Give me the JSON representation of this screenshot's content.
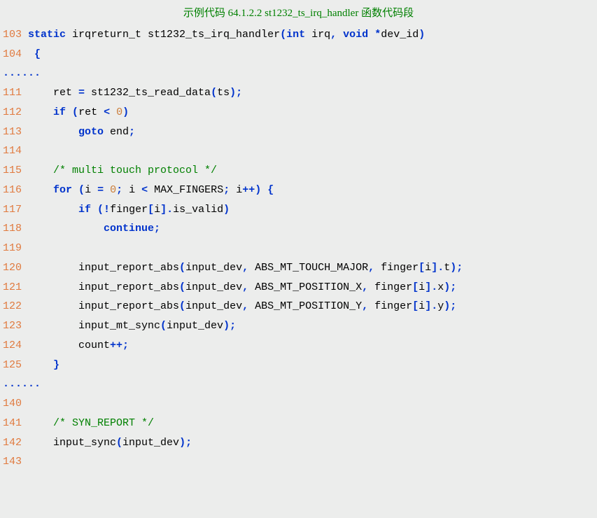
{
  "title": "示例代码 64.1.2.2 st1232_ts_irq_handler 函数代码段",
  "lines": [
    {
      "n": "103",
      "t": [
        {
          "c": "kw",
          "s": "static"
        },
        {
          "c": "plain",
          "s": " irqreturn_t st1232_ts_irq_handler"
        },
        {
          "c": "punct",
          "s": "("
        },
        {
          "c": "type",
          "s": "int"
        },
        {
          "c": "plain",
          "s": " irq"
        },
        {
          "c": "punct",
          "s": ","
        },
        {
          "c": "plain",
          "s": " "
        },
        {
          "c": "type",
          "s": "void"
        },
        {
          "c": "plain",
          "s": " "
        },
        {
          "c": "punct",
          "s": "*"
        },
        {
          "c": "plain",
          "s": "dev_id"
        },
        {
          "c": "punct",
          "s": ")"
        }
      ]
    },
    {
      "n": "104",
      "t": [
        {
          "c": "plain",
          "s": " "
        },
        {
          "c": "punct",
          "s": "{"
        }
      ]
    },
    {
      "n": "",
      "ell": true
    },
    {
      "n": "111",
      "t": [
        {
          "c": "plain",
          "s": "    ret "
        },
        {
          "c": "punct",
          "s": "="
        },
        {
          "c": "plain",
          "s": " st1232_ts_read_data"
        },
        {
          "c": "punct",
          "s": "("
        },
        {
          "c": "plain",
          "s": "ts"
        },
        {
          "c": "punct",
          "s": ");"
        }
      ]
    },
    {
      "n": "112",
      "t": [
        {
          "c": "plain",
          "s": "    "
        },
        {
          "c": "kw",
          "s": "if"
        },
        {
          "c": "plain",
          "s": " "
        },
        {
          "c": "punct",
          "s": "("
        },
        {
          "c": "plain",
          "s": "ret "
        },
        {
          "c": "punct",
          "s": "<"
        },
        {
          "c": "plain",
          "s": " "
        },
        {
          "c": "num",
          "s": "0"
        },
        {
          "c": "punct",
          "s": ")"
        }
      ]
    },
    {
      "n": "113",
      "t": [
        {
          "c": "plain",
          "s": "        "
        },
        {
          "c": "kw",
          "s": "goto"
        },
        {
          "c": "plain",
          "s": " end"
        },
        {
          "c": "punct",
          "s": ";"
        }
      ]
    },
    {
      "n": "114",
      "t": [
        {
          "c": "plain",
          "s": ""
        }
      ]
    },
    {
      "n": "115",
      "t": [
        {
          "c": "plain",
          "s": "    "
        },
        {
          "c": "comment",
          "s": "/* multi touch protocol */"
        }
      ]
    },
    {
      "n": "116",
      "t": [
        {
          "c": "plain",
          "s": "    "
        },
        {
          "c": "kw",
          "s": "for"
        },
        {
          "c": "plain",
          "s": " "
        },
        {
          "c": "punct",
          "s": "("
        },
        {
          "c": "plain",
          "s": "i "
        },
        {
          "c": "punct",
          "s": "="
        },
        {
          "c": "plain",
          "s": " "
        },
        {
          "c": "num",
          "s": "0"
        },
        {
          "c": "punct",
          "s": ";"
        },
        {
          "c": "plain",
          "s": " i "
        },
        {
          "c": "punct",
          "s": "<"
        },
        {
          "c": "plain",
          "s": " MAX_FINGERS"
        },
        {
          "c": "punct",
          "s": ";"
        },
        {
          "c": "plain",
          "s": " i"
        },
        {
          "c": "punct",
          "s": "++)"
        },
        {
          "c": "plain",
          "s": " "
        },
        {
          "c": "punct",
          "s": "{"
        }
      ]
    },
    {
      "n": "117",
      "t": [
        {
          "c": "plain",
          "s": "        "
        },
        {
          "c": "kw",
          "s": "if"
        },
        {
          "c": "plain",
          "s": " "
        },
        {
          "c": "punct",
          "s": "(!"
        },
        {
          "c": "plain",
          "s": "finger"
        },
        {
          "c": "punct",
          "s": "["
        },
        {
          "c": "plain",
          "s": "i"
        },
        {
          "c": "punct",
          "s": "]."
        },
        {
          "c": "plain",
          "s": "is_valid"
        },
        {
          "c": "punct",
          "s": ")"
        }
      ]
    },
    {
      "n": "118",
      "t": [
        {
          "c": "plain",
          "s": "            "
        },
        {
          "c": "kw",
          "s": "continue"
        },
        {
          "c": "punct",
          "s": ";"
        }
      ]
    },
    {
      "n": "119",
      "t": [
        {
          "c": "plain",
          "s": ""
        }
      ]
    },
    {
      "n": "120",
      "t": [
        {
          "c": "plain",
          "s": "        input_report_abs"
        },
        {
          "c": "punct",
          "s": "("
        },
        {
          "c": "plain",
          "s": "input_dev"
        },
        {
          "c": "punct",
          "s": ","
        },
        {
          "c": "plain",
          "s": " ABS_MT_TOUCH_MAJOR"
        },
        {
          "c": "punct",
          "s": ","
        },
        {
          "c": "plain",
          "s": " finger"
        },
        {
          "c": "punct",
          "s": "["
        },
        {
          "c": "plain",
          "s": "i"
        },
        {
          "c": "punct",
          "s": "]."
        },
        {
          "c": "plain",
          "s": "t"
        },
        {
          "c": "punct",
          "s": ");"
        }
      ]
    },
    {
      "n": "121",
      "t": [
        {
          "c": "plain",
          "s": "        input_report_abs"
        },
        {
          "c": "punct",
          "s": "("
        },
        {
          "c": "plain",
          "s": "input_dev"
        },
        {
          "c": "punct",
          "s": ","
        },
        {
          "c": "plain",
          "s": " ABS_MT_POSITION_X"
        },
        {
          "c": "punct",
          "s": ","
        },
        {
          "c": "plain",
          "s": " finger"
        },
        {
          "c": "punct",
          "s": "["
        },
        {
          "c": "plain",
          "s": "i"
        },
        {
          "c": "punct",
          "s": "]."
        },
        {
          "c": "plain",
          "s": "x"
        },
        {
          "c": "punct",
          "s": ");"
        }
      ]
    },
    {
      "n": "122",
      "t": [
        {
          "c": "plain",
          "s": "        input_report_abs"
        },
        {
          "c": "punct",
          "s": "("
        },
        {
          "c": "plain",
          "s": "input_dev"
        },
        {
          "c": "punct",
          "s": ","
        },
        {
          "c": "plain",
          "s": " ABS_MT_POSITION_Y"
        },
        {
          "c": "punct",
          "s": ","
        },
        {
          "c": "plain",
          "s": " finger"
        },
        {
          "c": "punct",
          "s": "["
        },
        {
          "c": "plain",
          "s": "i"
        },
        {
          "c": "punct",
          "s": "]."
        },
        {
          "c": "plain",
          "s": "y"
        },
        {
          "c": "punct",
          "s": ");"
        }
      ]
    },
    {
      "n": "123",
      "t": [
        {
          "c": "plain",
          "s": "        input_mt_sync"
        },
        {
          "c": "punct",
          "s": "("
        },
        {
          "c": "plain",
          "s": "input_dev"
        },
        {
          "c": "punct",
          "s": ");"
        }
      ]
    },
    {
      "n": "124",
      "t": [
        {
          "c": "plain",
          "s": "        count"
        },
        {
          "c": "punct",
          "s": "++;"
        }
      ]
    },
    {
      "n": "125",
      "t": [
        {
          "c": "plain",
          "s": "    "
        },
        {
          "c": "punct",
          "s": "}"
        }
      ]
    },
    {
      "n": "",
      "ell": true
    },
    {
      "n": "140",
      "t": [
        {
          "c": "plain",
          "s": ""
        }
      ]
    },
    {
      "n": "141",
      "t": [
        {
          "c": "plain",
          "s": "    "
        },
        {
          "c": "comment",
          "s": "/* SYN_REPORT */"
        }
      ]
    },
    {
      "n": "142",
      "t": [
        {
          "c": "plain",
          "s": "    input_sync"
        },
        {
          "c": "punct",
          "s": "("
        },
        {
          "c": "plain",
          "s": "input_dev"
        },
        {
          "c": "punct",
          "s": ");"
        }
      ]
    },
    {
      "n": "143",
      "t": [
        {
          "c": "plain",
          "s": ""
        }
      ]
    }
  ],
  "ellipsis_text": "......"
}
